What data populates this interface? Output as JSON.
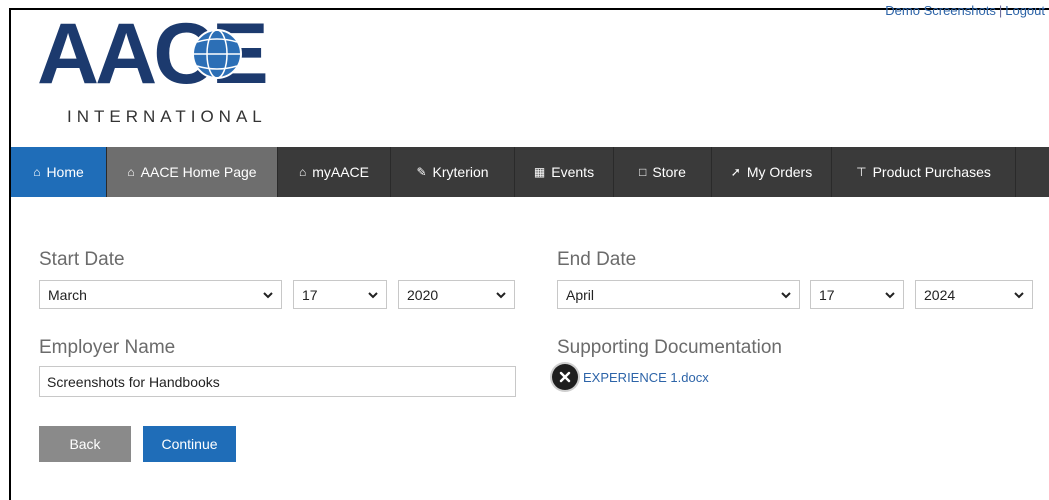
{
  "top_links": {
    "demo": "Demo Screenshots",
    "separator": "|",
    "logout": "Logout"
  },
  "logo": {
    "main": "AACE",
    "sub": "INTERNATIONAL"
  },
  "nav": [
    {
      "label": "Home",
      "icon": "home-icon"
    },
    {
      "label": "AACE Home Page",
      "icon": "home-icon"
    },
    {
      "label": "myAACE",
      "icon": "home-icon"
    },
    {
      "label": "Kryterion",
      "icon": "edit-icon"
    },
    {
      "label": "Events",
      "icon": "calendar-icon"
    },
    {
      "label": "Store",
      "icon": "cart-icon"
    },
    {
      "label": "My Orders",
      "icon": "pin-icon"
    },
    {
      "label": "Product Purchases",
      "icon": "filter-icon"
    }
  ],
  "form": {
    "start_date": {
      "label": "Start Date",
      "month": "March",
      "day": "17",
      "year": "2020"
    },
    "end_date": {
      "label": "End Date",
      "month": "April",
      "day": "17",
      "year": "2024"
    },
    "employer": {
      "label": "Employer Name",
      "value": "Screenshots for Handbooks"
    },
    "documentation": {
      "label": "Supporting Documentation",
      "file": "EXPERIENCE 1.docx"
    }
  },
  "buttons": {
    "back": "Back",
    "continue": "Continue"
  },
  "colors": {
    "nav_active": "#1f6db8",
    "nav_bg": "#3a3a3a",
    "logo_blue": "#1c3a6e"
  }
}
